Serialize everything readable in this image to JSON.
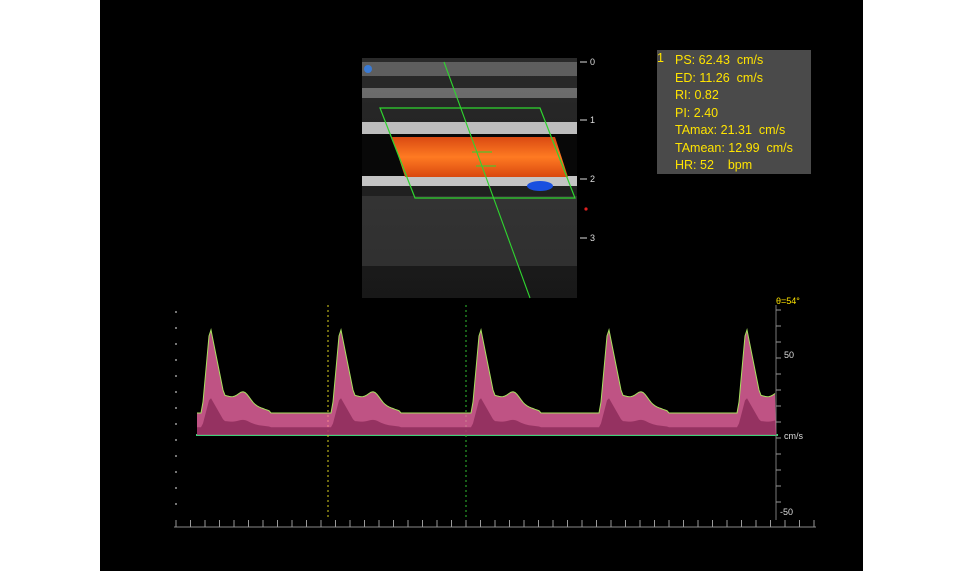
{
  "measurements": {
    "index": "1",
    "rows": [
      {
        "label": "PS:",
        "value": "62.43",
        "unit": "cm/s"
      },
      {
        "label": "ED:",
        "value": "11.26",
        "unit": "cm/s"
      },
      {
        "label": "RI:",
        "value": "0.82",
        "unit": ""
      },
      {
        "label": "PI:",
        "value": "2.40",
        "unit": ""
      },
      {
        "label": "TAmax:",
        "value": "21.31",
        "unit": "cm/s"
      },
      {
        "label": "TAmean:",
        "value": "12.99",
        "unit": "cm/s"
      },
      {
        "label": "HR:",
        "value": "52",
        "unit": "bpm"
      }
    ]
  },
  "bmode": {
    "depth_labels": [
      "0",
      "1",
      "2",
      "3"
    ]
  },
  "doppler": {
    "angle_label": "θ=54°",
    "unit_label": "cm/s",
    "scale_labels": [
      "50",
      "-50"
    ]
  },
  "colors": {
    "text_yellow": "#ffe400",
    "baseline": "#3fd17a",
    "spectrum": "#ff6fb0",
    "color_flow": "#ff6a1a",
    "sample_gate": "#2fd52f"
  }
}
